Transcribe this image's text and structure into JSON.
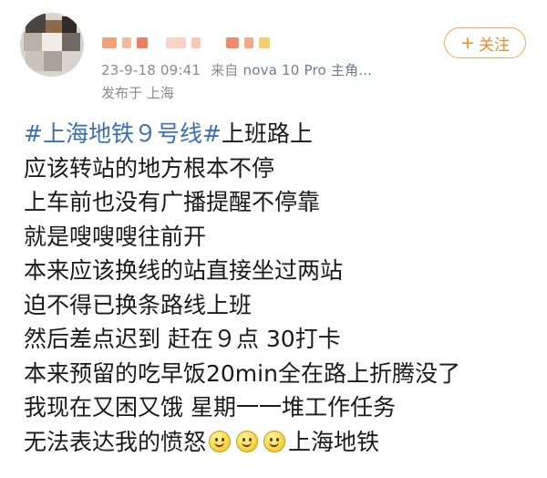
{
  "header": {
    "timestamp": "23-9-18 09:41",
    "source_prefix": "来自",
    "device": "nova 10 Pro 主角...",
    "location": "发布于 上海",
    "follow_label": "关注",
    "follow_icon": "plus-icon"
  },
  "content": {
    "topic_1": "#上海地铁９号线#",
    "line_1_rest": "上班路上",
    "lines": [
      "应该转站的地方根本不停",
      "上车前也没有广播提醒不停靠",
      "就是嗖嗖嗖往前开",
      "本来应该换线的站直接坐过两站",
      "迫不得已换条路线上班",
      "然后差点迟到 赶在９点 30打卡",
      "本来预留的吃早饭20min全在路上折腾没了",
      "我现在又困又饿 星期一一堆工作任务"
    ],
    "last_line_text": "无法表达我的愤怒",
    "emoji_icon": "smile-emoji-icon",
    "last_line_tail": "上海地铁"
  },
  "colors": {
    "topic": "#3b6fb6",
    "follow_accent": "#f08a24",
    "meta_text": "#8a8a8a"
  }
}
